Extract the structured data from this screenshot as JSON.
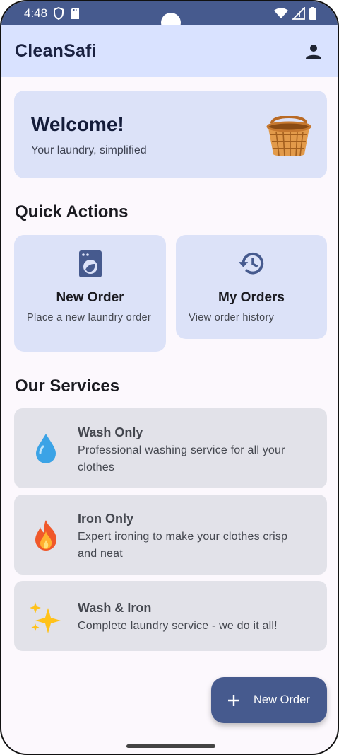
{
  "status_bar": {
    "time": "4:48"
  },
  "app": {
    "title": "CleanSafi"
  },
  "welcome": {
    "title": "Welcome!",
    "subtitle": "Your laundry, simplified"
  },
  "quick_actions": {
    "title": "Quick Actions",
    "items": [
      {
        "title": "New Order",
        "description": "Place a new laundry order",
        "icon": "washing-machine-icon"
      },
      {
        "title": "My Orders",
        "description": "View order history",
        "icon": "history-icon"
      }
    ]
  },
  "services": {
    "title": "Our Services",
    "items": [
      {
        "title": "Wash Only",
        "description": "Professional washing service for all your clothes",
        "icon": "droplet-icon"
      },
      {
        "title": "Iron Only",
        "description": "Expert ironing to make your clothes crisp and neat",
        "icon": "fire-icon"
      },
      {
        "title": "Wash & Iron",
        "description": "Complete laundry service - we do it all!",
        "icon": "sparkles-icon"
      }
    ]
  },
  "fab": {
    "label": "New Order"
  },
  "colors": {
    "primary": "#465A8E",
    "app_bar": "#D9E2FF",
    "card": "#DCE2F8",
    "service_card": "#E2E2E9"
  }
}
